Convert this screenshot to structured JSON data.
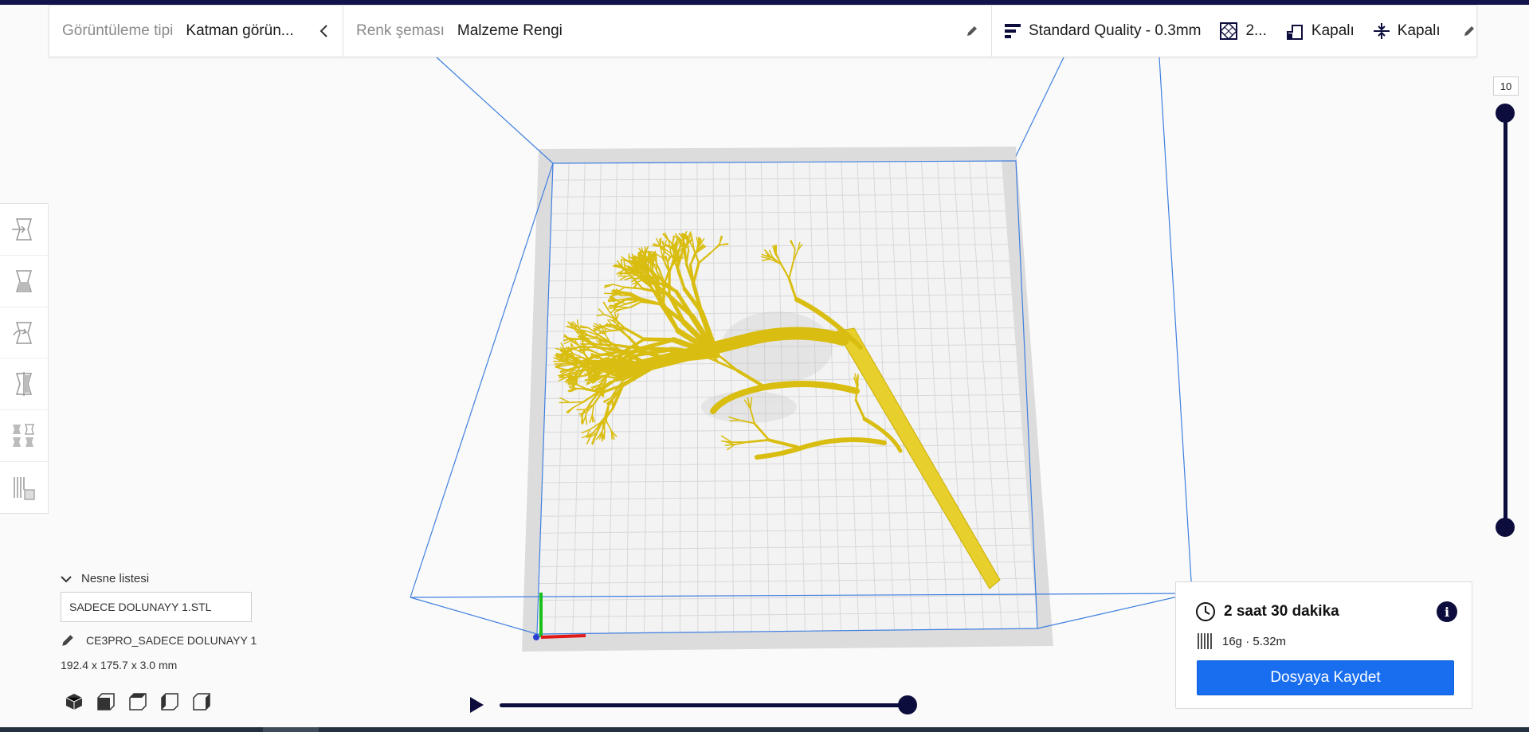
{
  "header": {
    "view_type_label": "Görüntüleme tipi",
    "view_type_value": "Katman görün...",
    "color_scheme_label": "Renk şeması",
    "color_scheme_value": "Malzeme Rengi",
    "profile": "Standard Quality - 0.3mm",
    "infill": "2...",
    "support": "Kapalı",
    "adhesion": "Kapalı"
  },
  "layer_slider": {
    "current_layer": "10"
  },
  "object_list": {
    "toggle_label": "Nesne listesi",
    "file_name": "SADECE DOLUNAYY 1.STL",
    "job_name": "CE3PRO_SADECE DOLUNAYY 1",
    "dimensions": "192.4 x 175.7 x 3.0 mm"
  },
  "print_info": {
    "time": "2 saat 30 dakika",
    "material": "16g · 5.32m",
    "save_label": "Dosyaya Kaydet"
  },
  "icons": {
    "toolbar": [
      "move-icon",
      "scale-icon",
      "rotate-icon",
      "mirror-icon",
      "per-model-settings-icon",
      "support-blocker-icon"
    ],
    "view_buttons": [
      "3d-view-icon",
      "front-view-icon",
      "top-view-icon",
      "left-view-icon",
      "right-view-icon"
    ]
  },
  "colors": {
    "accent": "#196ef0",
    "dark": "#0c0d3c",
    "model": "#e7cf2a",
    "build_volume": "#3f7fe0"
  }
}
